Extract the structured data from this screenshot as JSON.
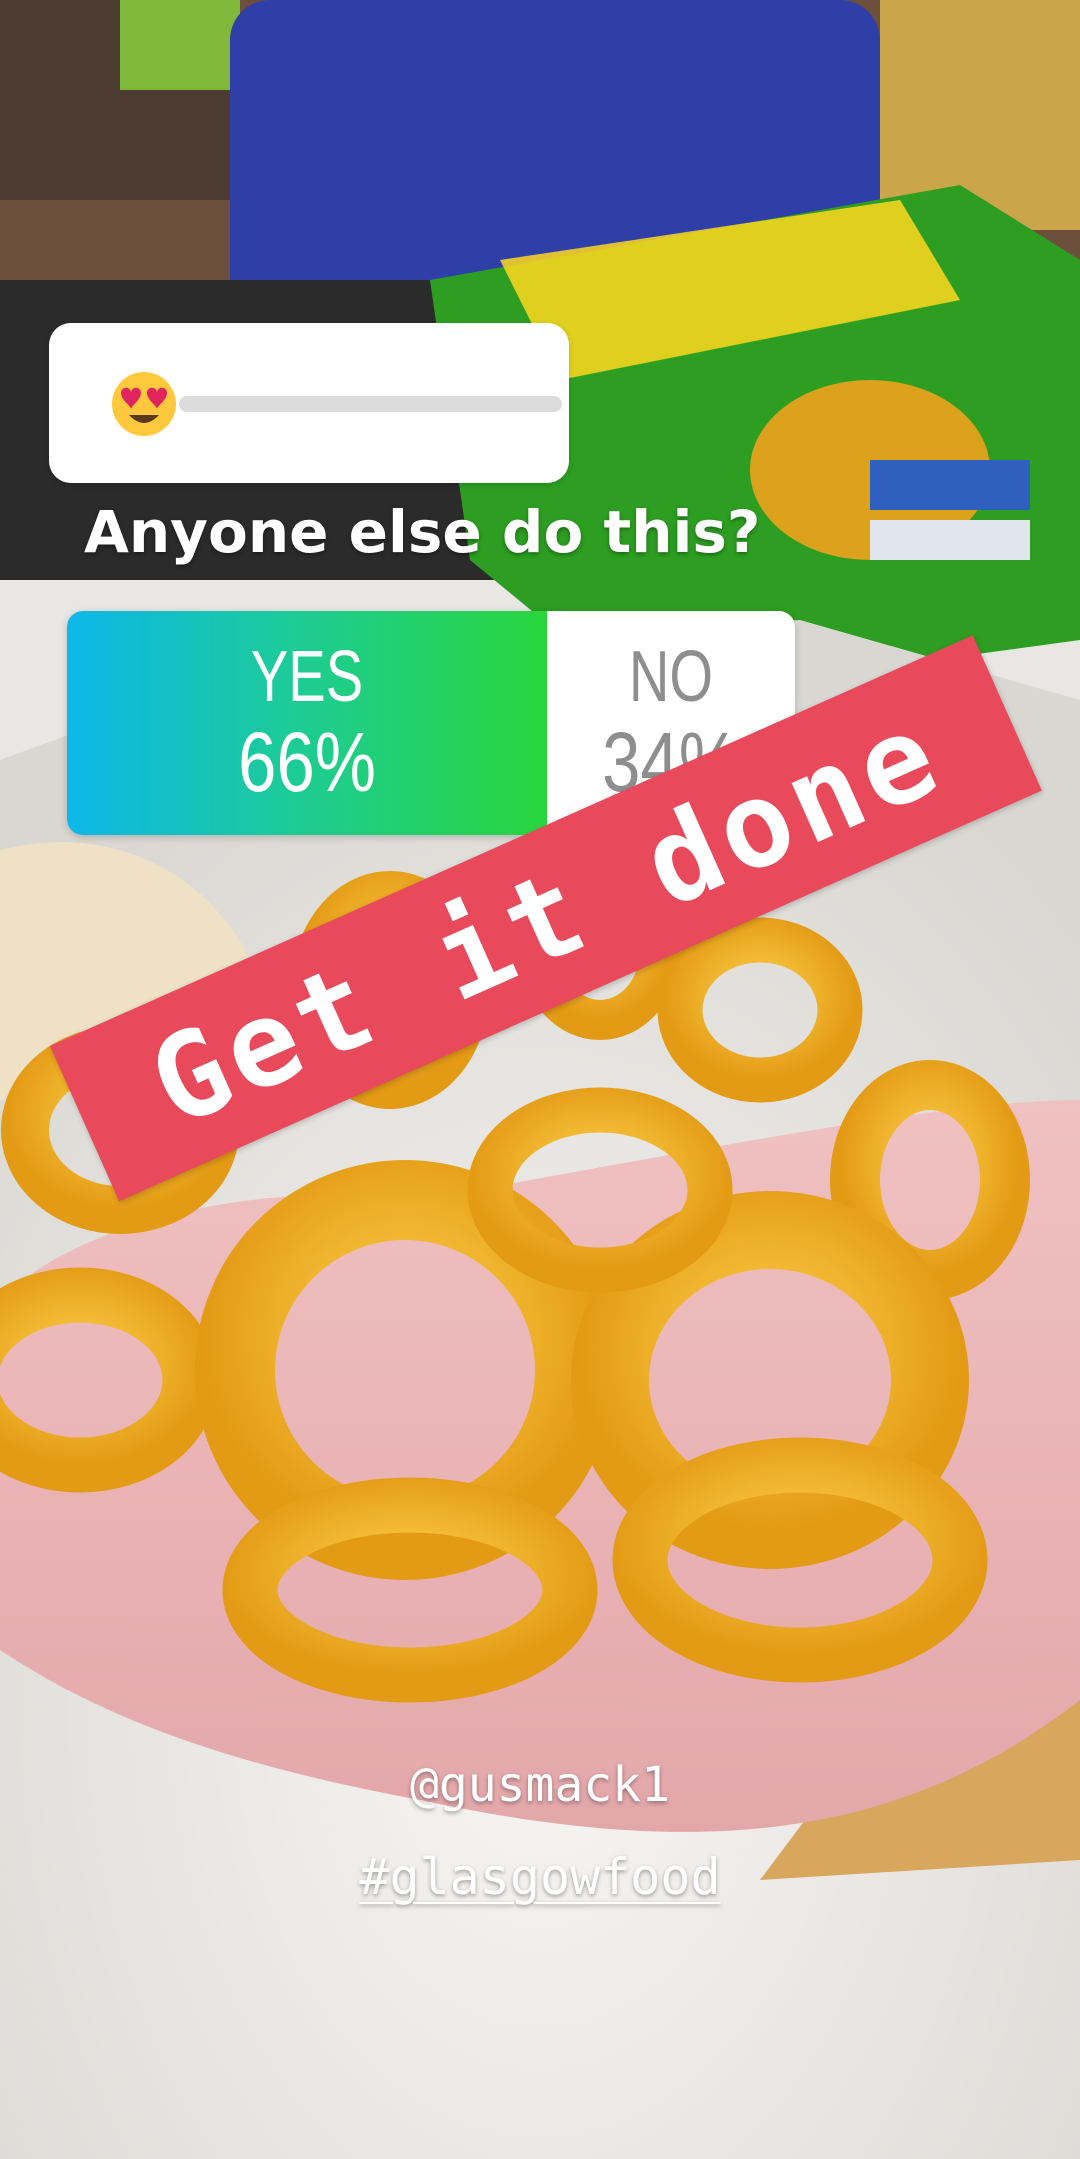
{
  "slider": {
    "emoji": "heart-eyes-emoji",
    "value": 0
  },
  "poll": {
    "question": "Anyone else do this?",
    "options": [
      {
        "label": "YES",
        "percent": "66%"
      },
      {
        "label": "NO",
        "percent": "34%"
      }
    ],
    "yes_fraction": 0.66
  },
  "stickers": {
    "banner_text": "Get it done",
    "handle": "@gusmack1",
    "hashtag": "#glasgowfood"
  },
  "colors": {
    "banner": "#e84a5c",
    "poll_gradient_start": "#0db7ea",
    "poll_gradient_end": "#2ad63c",
    "poll_no_text": "#8e8e8e"
  }
}
